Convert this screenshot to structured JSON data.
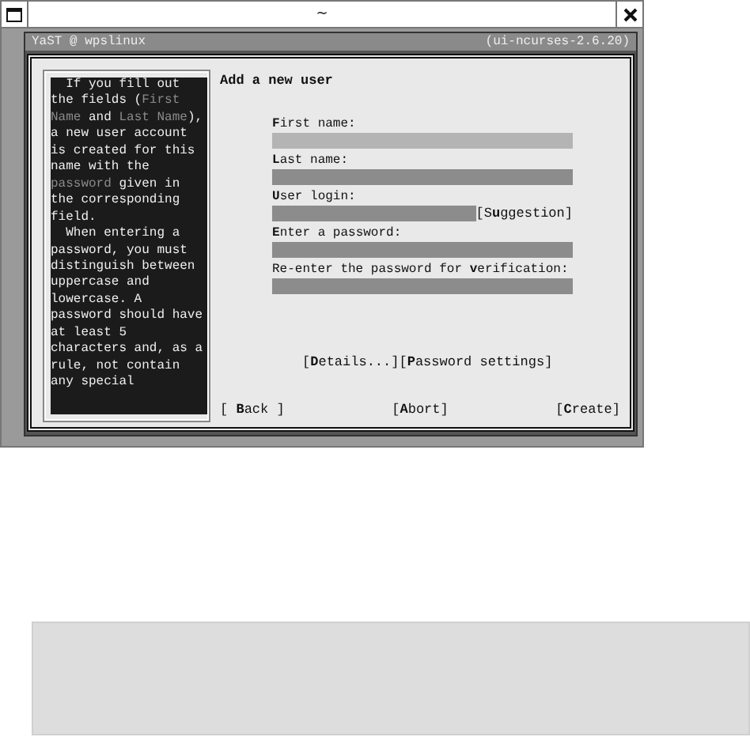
{
  "window": {
    "title": "~"
  },
  "terminal": {
    "title": "YaST @ wpslinux",
    "version": "(ui-ncurses-2.6.20)"
  },
  "help": {
    "text": "  If you fill out\nthe fields (**First**\n**Name** and **Last Name**),\na new user account\nis created for this\nname with the\n**password** given in\nthe corresponding\nfield.\n  When entering a\npassword, you must\ndistinguish between\nuppercase and\nlowercase. A\npassword should have\nat least 5\ncharacters and, as a\nrule, not contain\nany special"
  },
  "dialog": {
    "title": "Add a new user",
    "fields": [
      {
        "label": "**F**irst name:",
        "focused": true
      },
      {
        "label": "**L**ast name:",
        "focused": false
      },
      {
        "label": "**U**ser login:",
        "focused": false,
        "button": "[S**u**ggestion]"
      },
      {
        "label": "**E**nter a password:",
        "focused": false
      },
      {
        "label": "Re-enter the password for **v**erification:",
        "focused": false
      }
    ],
    "options": [
      "[**D**etails...]",
      "[**P**assword settings]"
    ],
    "buttons": [
      "[ **B**ack ]",
      "[**A**bort]",
      "[**C**reate]"
    ]
  }
}
